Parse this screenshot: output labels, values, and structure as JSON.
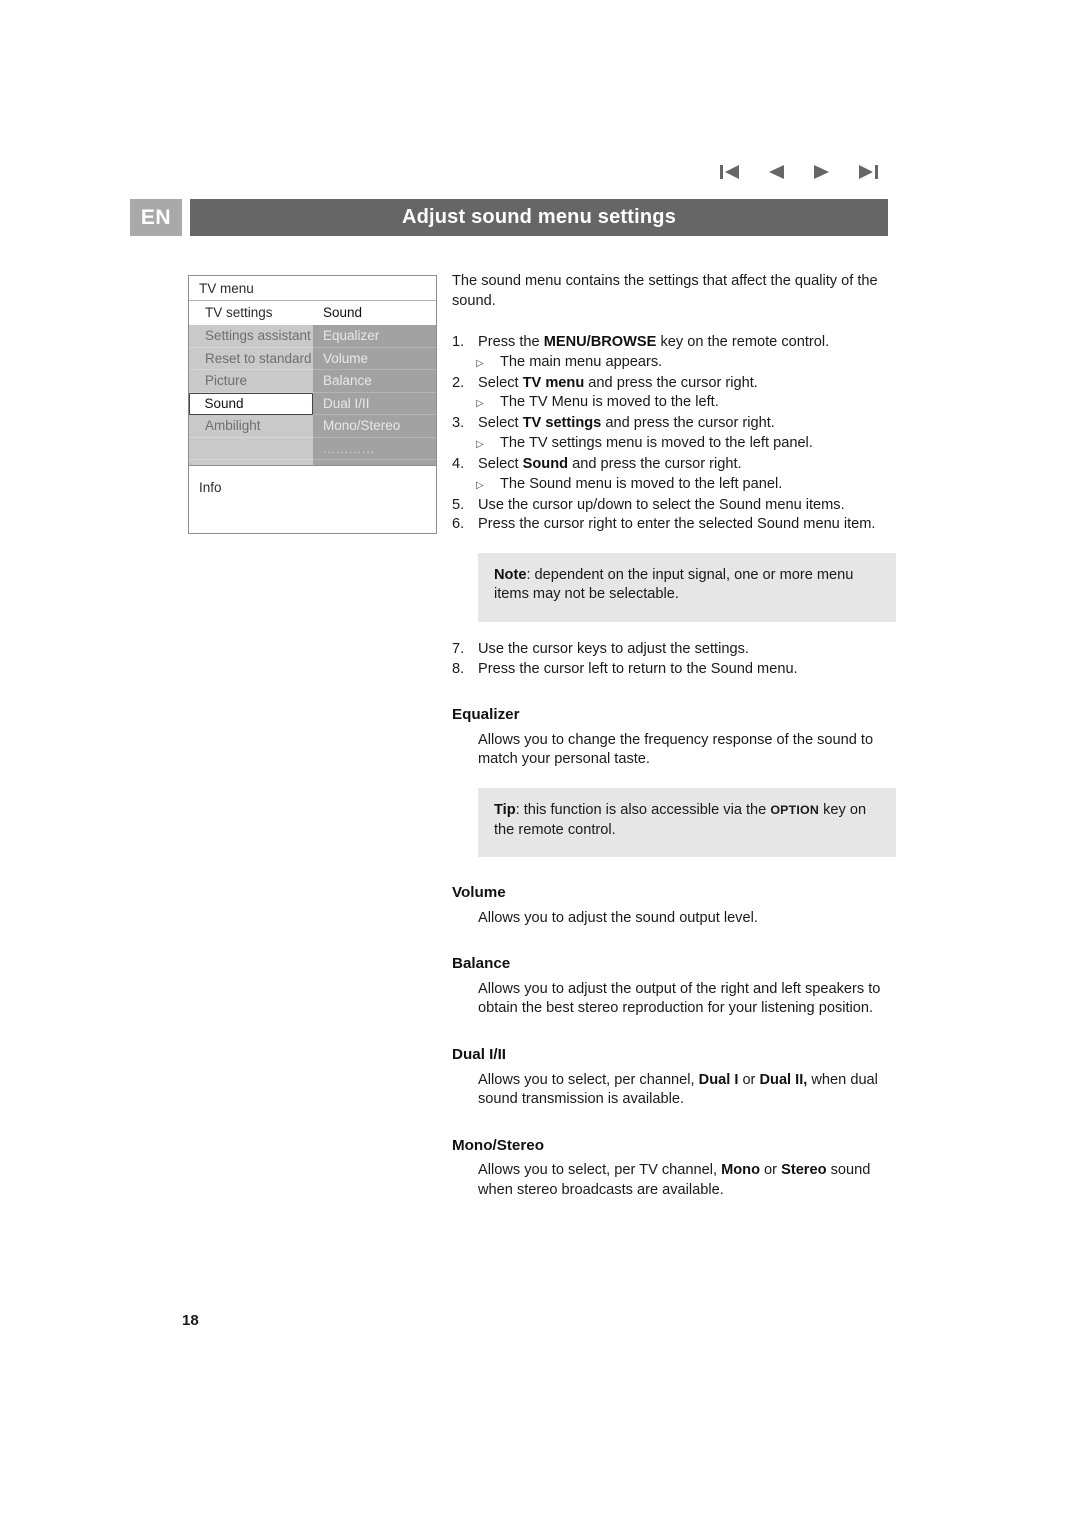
{
  "document": {
    "language_badge": "EN",
    "title": "Adjust sound menu settings",
    "page_number": "18"
  },
  "nav": {
    "items": [
      {
        "name": "first-page",
        "glyph": "skip-back"
      },
      {
        "name": "previous-page",
        "glyph": "prev"
      },
      {
        "name": "next-page",
        "glyph": "next"
      },
      {
        "name": "last-page",
        "glyph": "skip-forward"
      }
    ]
  },
  "tv_menu_mock": {
    "header": "TV menu",
    "subheader_left": "TV settings",
    "subheader_right": "Sound",
    "left_items": [
      "Settings assistant",
      "Reset to standard",
      "Picture",
      "Sound",
      "Ambilight",
      "",
      ""
    ],
    "left_selected": "Sound",
    "right_items": [
      "Equalizer",
      "Volume",
      "Balance",
      "Dual I/II",
      "Mono/Stereo",
      "............",
      ""
    ],
    "footer": "Info"
  },
  "content": {
    "intro": "The sound menu contains the settings that affect the quality of the sound.",
    "steps": [
      {
        "num": "1.",
        "pre": "Press the ",
        "bold": "MENU/BROWSE",
        "post": " key on the remote control.",
        "sub": "The main menu appears."
      },
      {
        "num": "2.",
        "pre": "Select ",
        "bold": "TV menu",
        "post": " and press the cursor right.",
        "sub": "The TV Menu is moved to the left."
      },
      {
        "num": "3.",
        "pre": "Select ",
        "bold": "TV settings",
        "post": " and press the cursor right.",
        "sub": "The TV settings menu is moved to the left panel."
      },
      {
        "num": "4.",
        "pre": "Select ",
        "bold": "Sound",
        "post": " and press the cursor right.",
        "sub": "The Sound menu is moved to the left panel."
      },
      {
        "num": "5.",
        "pre": "Use the cursor up/down to select the Sound menu items.",
        "bold": "",
        "post": "",
        "sub": ""
      },
      {
        "num": "6.",
        "pre": "Press the cursor right to enter the selected Sound menu item.",
        "bold": "",
        "post": "",
        "sub": ""
      }
    ],
    "note_box": {
      "label": "Note",
      "text": ": dependent on the input signal, one or more menu items may not be selectable."
    },
    "steps_after": [
      {
        "num": "7.",
        "pre": "Use the cursor keys to adjust the settings.",
        "bold": "",
        "post": "",
        "sub": ""
      },
      {
        "num": "8.",
        "pre": "Press the cursor left to return to the Sound menu.",
        "bold": "",
        "post": "",
        "sub": ""
      }
    ],
    "sections": [
      {
        "heading": "Equalizer",
        "body": "Allows you to change the frequency response of the sound to match your personal taste."
      },
      {
        "heading": "Volume",
        "body": "Allows you to adjust the sound output level."
      },
      {
        "heading": "Balance",
        "body": "Allows you to adjust the output of the right and left speakers to obtain the best stereo reproduction for your listening position."
      },
      {
        "heading": "Dual I/II",
        "body_pre": "Allows you to select, per channel, ",
        "body_b1": "Dual I",
        "body_mid": " or ",
        "body_b2": "Dual II,",
        "body_post": " when dual sound transmission is available."
      },
      {
        "heading": "Mono/Stereo",
        "body_pre": "Allows you to select, per TV channel, ",
        "body_b1": "Mono",
        "body_mid": " or ",
        "body_b2": "Stereo",
        "body_post": " sound when stereo broadcasts are available."
      }
    ],
    "tip_box": {
      "label": "Tip",
      "pre": ": this function is also accessible via the ",
      "key": "OPTION",
      "post": " key on the remote control."
    }
  },
  "colors": {
    "title_bar": "#666666",
    "badge": "#a9a9a9",
    "callout_bg": "#e6e6e6",
    "menu_left_bg": "#c9c9c9",
    "menu_right_bg": "#a2a2a2"
  }
}
